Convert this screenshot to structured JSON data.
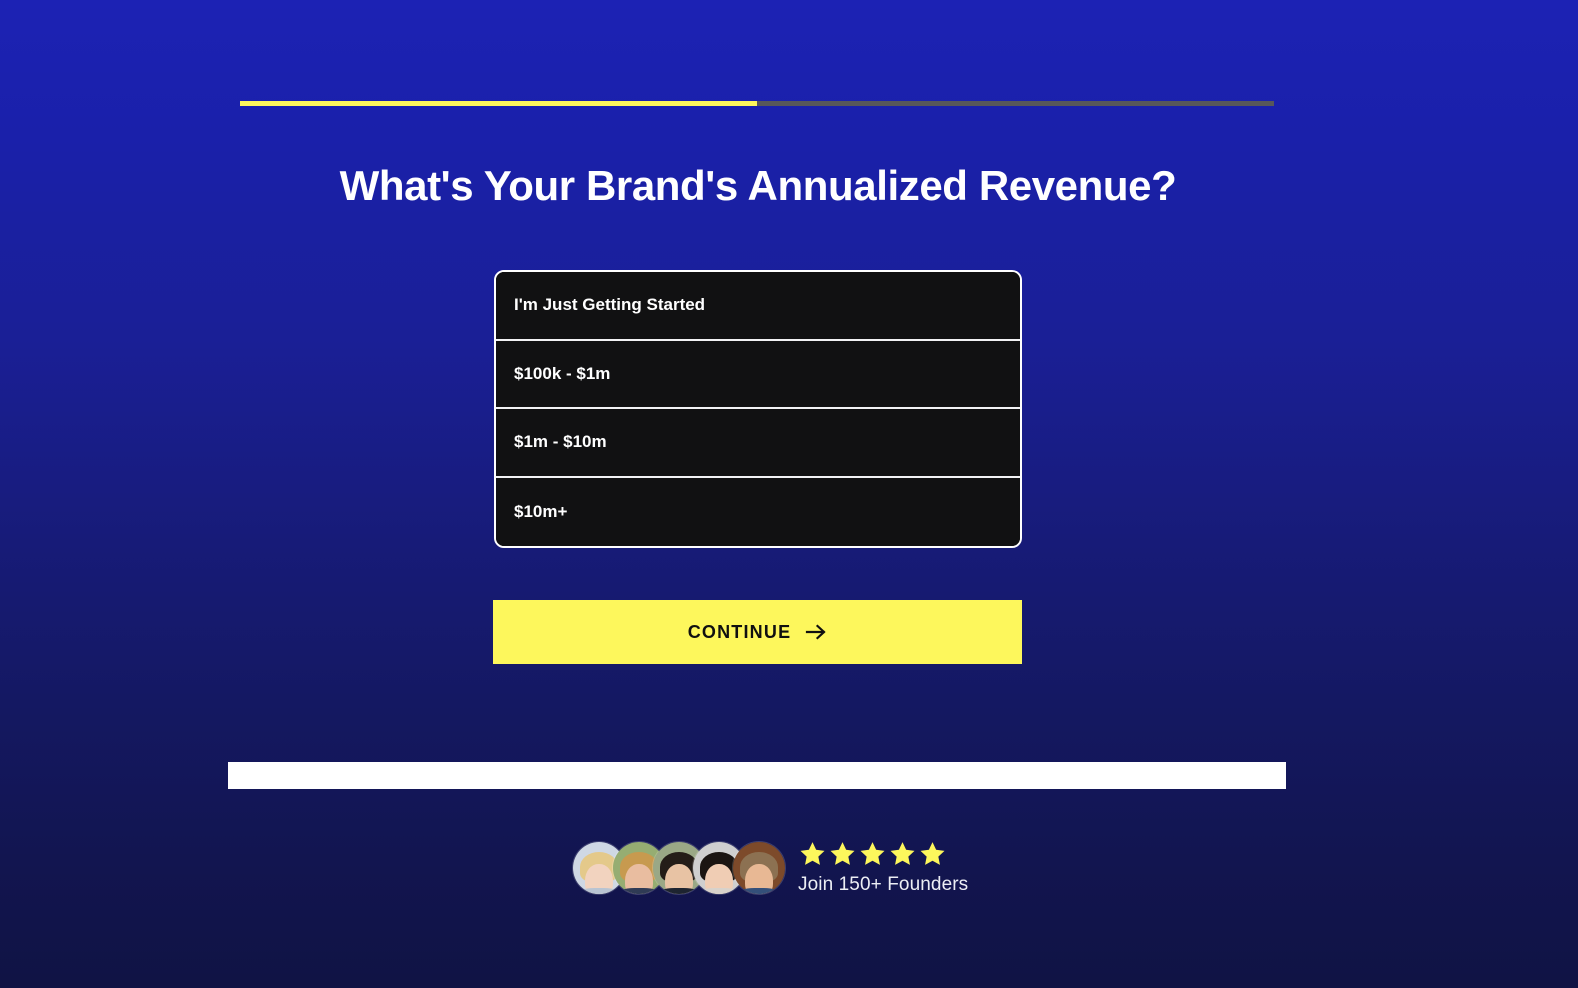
{
  "theme": {
    "bg_top": "#1c22b4",
    "bg_bottom": "#101344",
    "accent_yellow": "#fdf75c",
    "option_bg": "#111112",
    "option_border": "#ffffff",
    "progress_track": "#57575a",
    "text_light": "#ffffff",
    "star_color": "#fdf75c"
  },
  "progress": {
    "percent": 50,
    "label": ""
  },
  "headline": "What's Your Brand's Annualized Revenue?",
  "options": [
    {
      "label": "I'm Just Getting Started",
      "selected": false
    },
    {
      "label": "$100k - $1m",
      "selected": false
    },
    {
      "label": "$1m - $10m",
      "selected": false
    },
    {
      "label": "$10m+",
      "selected": false
    }
  ],
  "continue_button": {
    "label": "CONTINUE",
    "arrow_icon": "arrow-right-icon"
  },
  "social_proof": {
    "stars": 5,
    "star_glyph": "★",
    "join_text": "Join 150+ Founders",
    "avatars": [
      {
        "name": "founder-avatar-1",
        "bg": "#cfd8e4",
        "hair": "#e4c98a",
        "face": "#f2d3bf",
        "body": "#b9c4d2"
      },
      {
        "name": "founder-avatar-2",
        "bg": "#96ad72",
        "hair": "#c79a4f",
        "face": "#e9bda0",
        "body": "#2f3b55"
      },
      {
        "name": "founder-avatar-3",
        "bg": "#9aa886",
        "hair": "#241d18",
        "face": "#e8c3a4",
        "body": "#1d2430"
      },
      {
        "name": "founder-avatar-4",
        "bg": "#cfcfcf",
        "hair": "#1b1512",
        "face": "#f0cdb4",
        "body": "#d8d2cb"
      },
      {
        "name": "founder-avatar-5",
        "bg": "#7d4a2a",
        "hair": "#8c7152",
        "face": "#e8b894",
        "body": "#34507a"
      }
    ]
  }
}
